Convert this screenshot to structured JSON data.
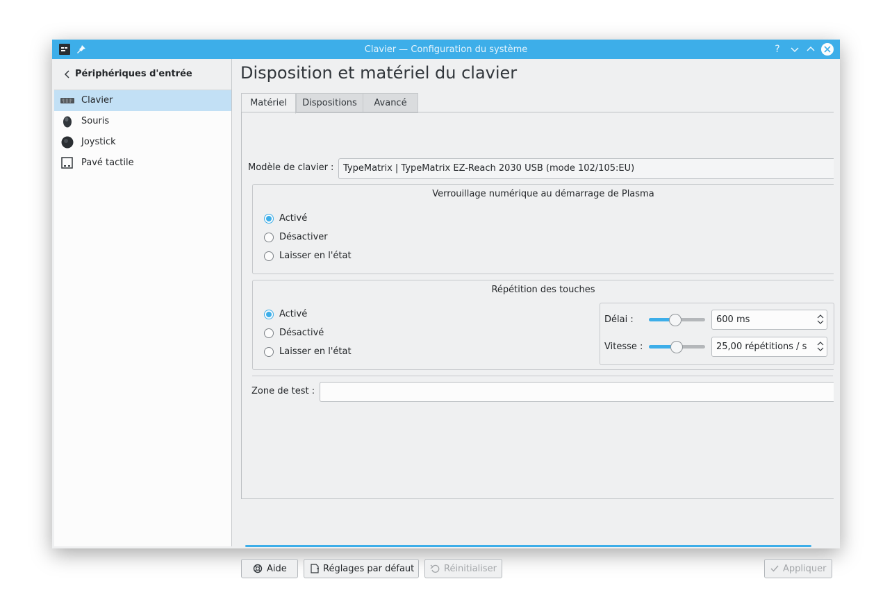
{
  "window": {
    "title": "Clavier — Configuration du système"
  },
  "sidebar": {
    "header": "Périphériques d'entrée",
    "items": [
      {
        "label": "Clavier",
        "icon": "keyboard-icon",
        "selected": true
      },
      {
        "label": "Souris",
        "icon": "mouse-icon",
        "selected": false
      },
      {
        "label": "Joystick",
        "icon": "joystick-icon",
        "selected": false
      },
      {
        "label": "Pavé tactile",
        "icon": "touchpad-icon",
        "selected": false
      }
    ]
  },
  "main": {
    "title": "Disposition et matériel du clavier",
    "tabs": [
      {
        "label": "Matériel",
        "active": true
      },
      {
        "label": "Dispositions",
        "active": false
      },
      {
        "label": "Avancé",
        "active": false
      }
    ],
    "keyboard_model": {
      "label": "Modèle de clavier :",
      "value": "TypeMatrix | TypeMatrix EZ-Reach 2030 USB (mode 102/105:EU)"
    },
    "numlock": {
      "title": "Verrouillage numérique au démarrage de Plasma",
      "options": [
        "Activé",
        "Désactiver",
        "Laisser en l'état"
      ],
      "selected": 0
    },
    "repeat": {
      "title": "Répétition des touches",
      "options": [
        "Activé",
        "Désactivé",
        "Laisser en l'état"
      ],
      "selected": 0,
      "delay": {
        "label": "Délai :",
        "value": "600 ms",
        "level": 0.47
      },
      "rate": {
        "label": "Vitesse :",
        "value": "25,00 répétitions / s",
        "level": 0.5
      }
    },
    "test_zone": {
      "label": "Zone de test :",
      "value": ""
    }
  },
  "buttons": {
    "help": "Aide",
    "defaults": "Réglages par défaut",
    "reset": "Réinitialiser",
    "apply": "Appliquer"
  },
  "colors": {
    "accent": "#3daee9",
    "selection": "#c2e0f5",
    "window": "#eff0f1"
  }
}
